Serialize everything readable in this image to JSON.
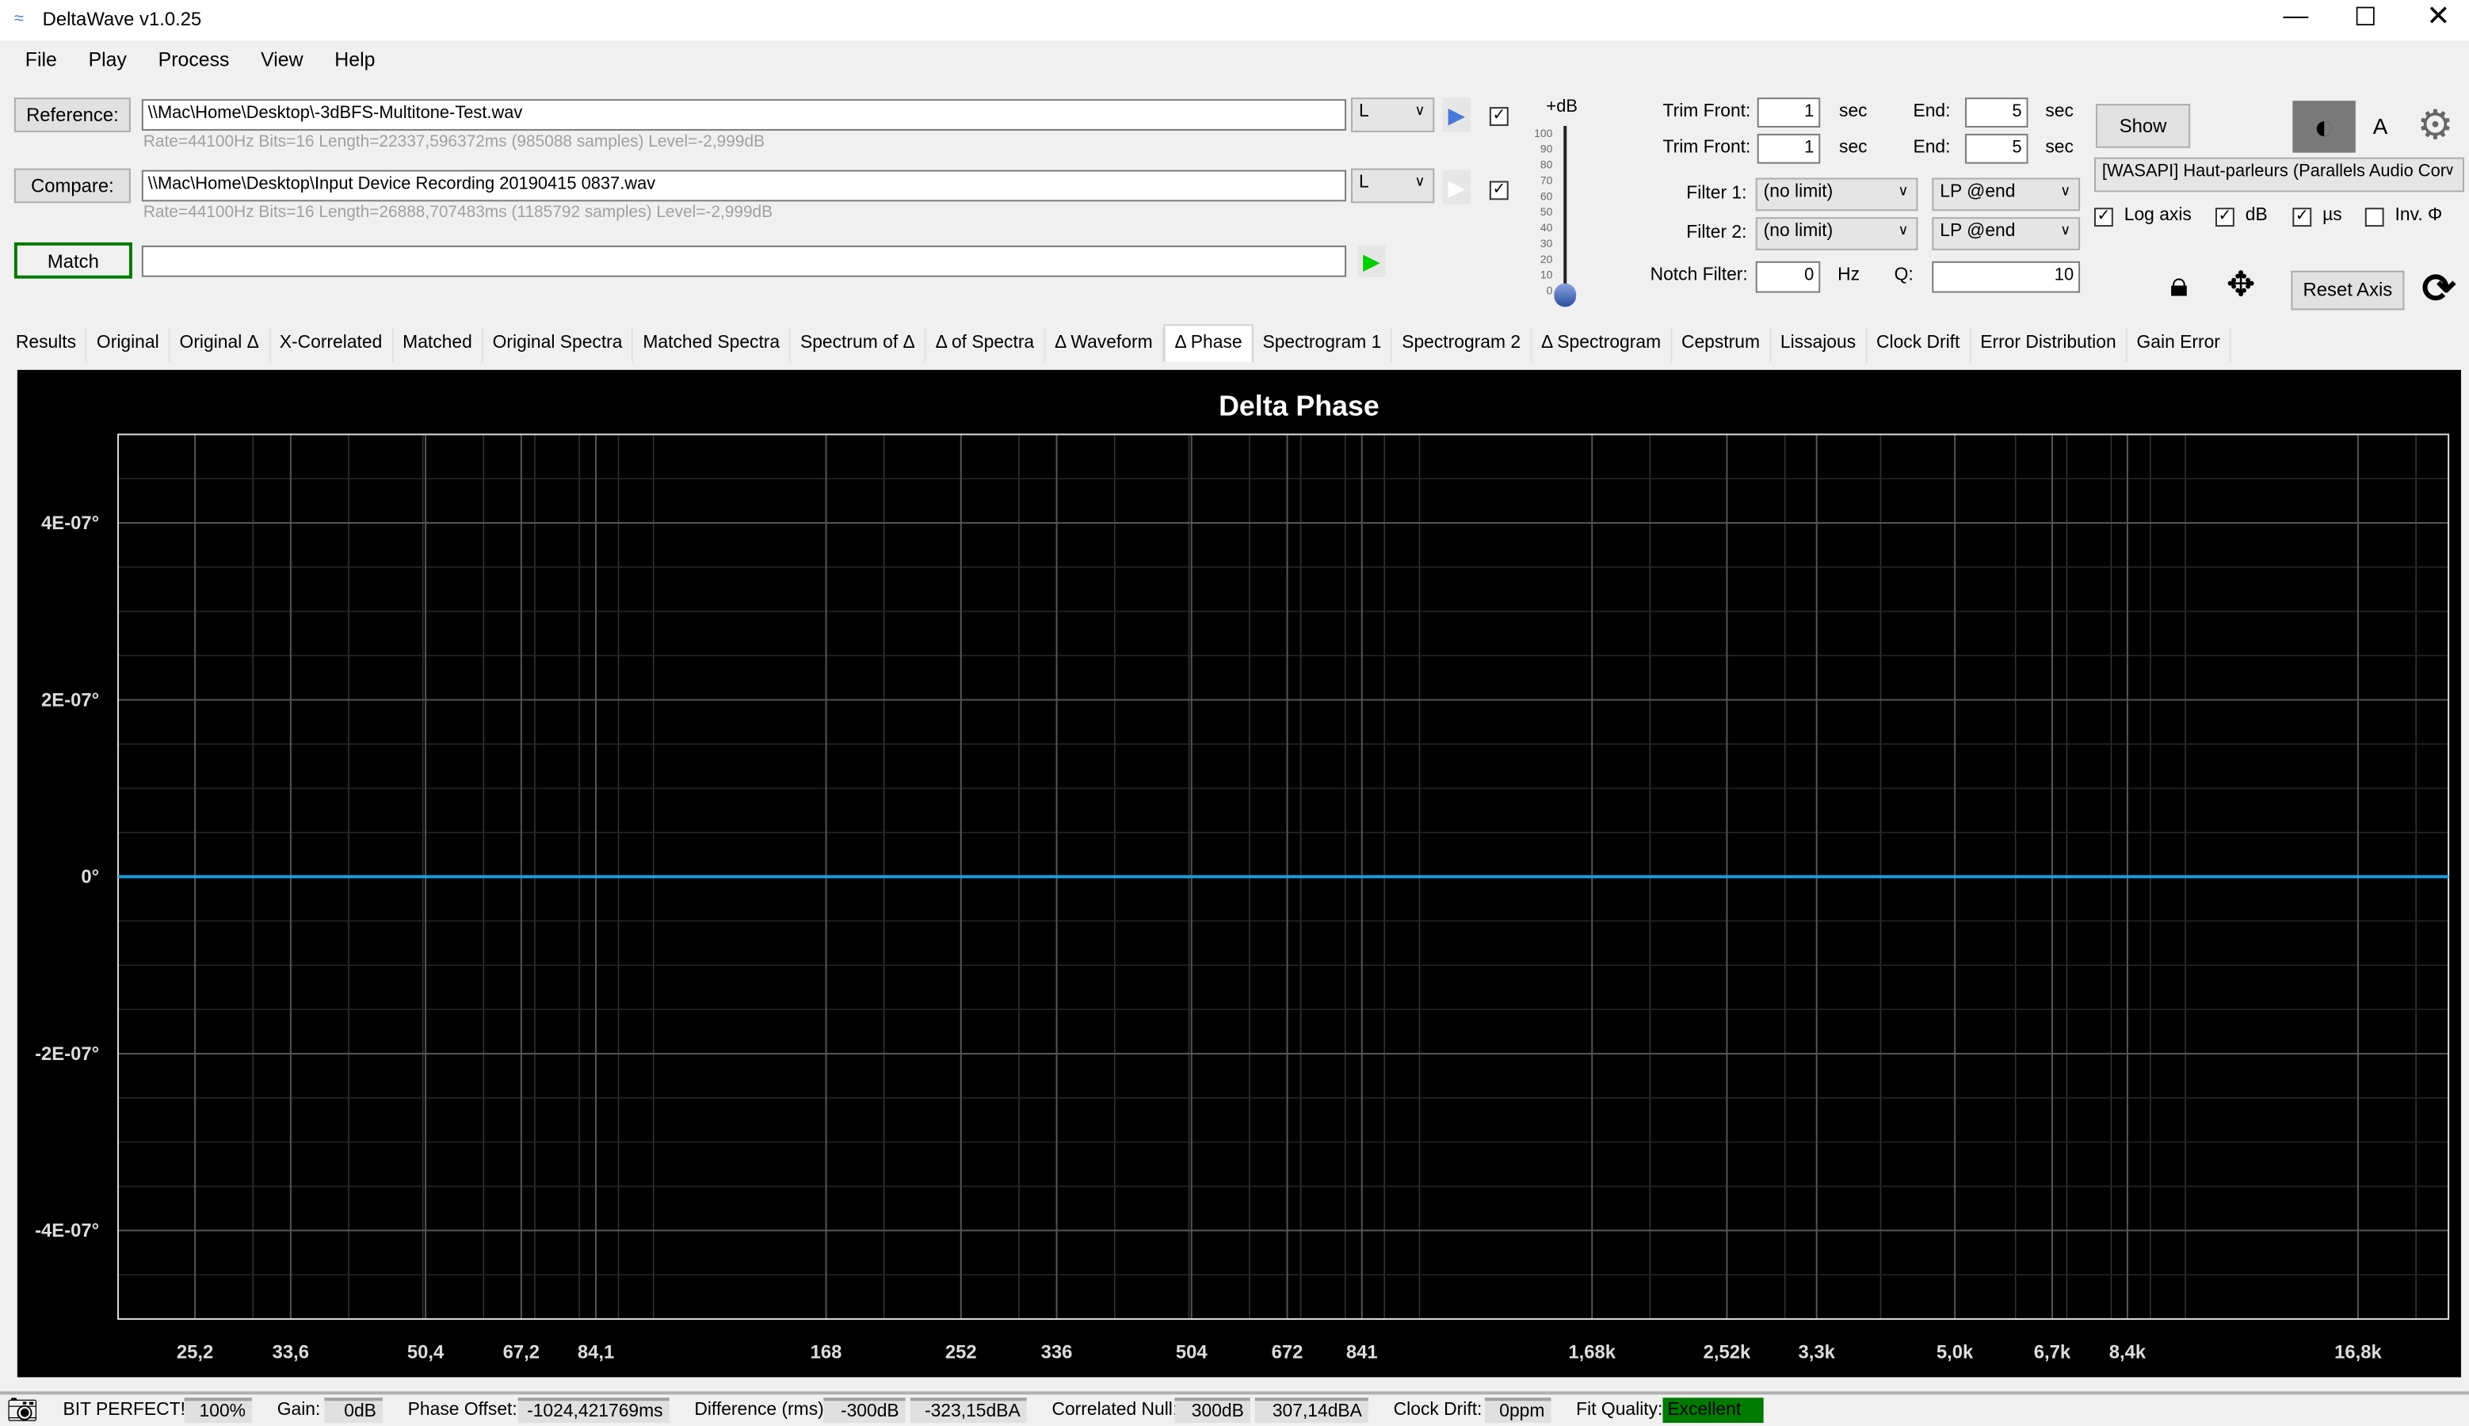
{
  "app": {
    "title": "DeltaWave v1.0.25"
  },
  "menu": [
    "File",
    "Play",
    "Process",
    "View",
    "Help"
  ],
  "reference": {
    "button": "Reference:",
    "path": "\\\\Mac\\Home\\Desktop\\-3dBFS-Multitone-Test.wav",
    "info": "Rate=44100Hz Bits=16 Length=22337,596372ms (985088 samples) Level=-2,999dB",
    "channel": "L",
    "checked": true
  },
  "compare": {
    "button": "Compare:",
    "path": "\\\\Mac\\Home\\Desktop\\Input Device Recording 20190415 0837.wav",
    "info": "Rate=44100Hz Bits=16 Length=26888,707483ms (1185792 samples) Level=-2,999dB",
    "channel": "L",
    "checked": true
  },
  "match": {
    "button": "Match",
    "value": ""
  },
  "volume": {
    "label": "+dB",
    "ticks": [
      "100",
      "90",
      "80",
      "70",
      "60",
      "50",
      "40",
      "30",
      "20",
      "10",
      "0"
    ],
    "level": 0
  },
  "trim": [
    {
      "label": "Trim Front:",
      "front": "1",
      "unit": "sec",
      "end_label": "End:",
      "end": "5",
      "end_unit": "sec"
    },
    {
      "label": "Trim Front:",
      "front": "1",
      "unit": "sec",
      "end_label": "End:",
      "end": "5",
      "end_unit": "sec"
    }
  ],
  "filters": [
    {
      "label": "Filter 1:",
      "value": "(no limit)",
      "type": "LP @end"
    },
    {
      "label": "Filter 2:",
      "value": "(no limit)",
      "type": "LP @end"
    }
  ],
  "notch": {
    "label": "Notch Filter:",
    "value": "0",
    "unit": "Hz",
    "q_label": "Q:",
    "q": "10"
  },
  "show_button": "Show",
  "a_label": "A",
  "device": "[WASAPI] Haut-parleurs (Parallels Audio Cor",
  "options": [
    {
      "label": "Log axis",
      "checked": true
    },
    {
      "label": "dB",
      "checked": true
    },
    {
      "label": "µs",
      "checked": true
    },
    {
      "label": "Inv. Φ",
      "checked": false
    }
  ],
  "reset_axis": "Reset Axis",
  "tabs": [
    "Results",
    "Original",
    "Original Δ",
    "X-Correlated",
    "Matched",
    "Original Spectra",
    "Matched Spectra",
    "Spectrum of Δ",
    "Δ of Spectra",
    "Δ Waveform",
    "Δ Phase",
    "Spectrogram 1",
    "Spectrogram 2",
    "Δ Spectrogram",
    "Cepstrum",
    "Lissajous",
    "Clock Drift",
    "Error Distribution",
    "Gain Error"
  ],
  "active_tab": "Δ Phase",
  "chart_data": {
    "type": "line",
    "title": "Delta Phase",
    "xlabel": "",
    "ylabel": "",
    "xscale": "log",
    "xlim": [
      20,
      22050
    ],
    "ylim": [
      -5e-07,
      5e-07
    ],
    "grid": true,
    "xticks": [
      25.2,
      33.6,
      50.4,
      67.2,
      84.1,
      168,
      252,
      336,
      504,
      672,
      841,
      1680,
      2520,
      3300,
      5000,
      6700,
      8400,
      16800
    ],
    "xtick_labels": [
      "25,2",
      "33,6",
      "50,4",
      "67,2",
      "84,1",
      "168",
      "252",
      "336",
      "504",
      "672",
      "841",
      "1,68k",
      "2,52k",
      "3,3k",
      "5,0k",
      "6,7k",
      "8,4k",
      "16,8k"
    ],
    "yticks": [
      4e-07,
      2e-07,
      0,
      -2e-07,
      -4e-07
    ],
    "ytick_labels": [
      "4E-07°",
      "2E-07°",
      "0°",
      "-2E-07°",
      "-4E-07°"
    ],
    "series": [
      {
        "x": [
          20,
          22050
        ],
        "y": [
          0,
          0
        ],
        "color": "#1e9bd7"
      }
    ]
  },
  "status": {
    "bit_perfect": "BIT PERFECT!",
    "bit_pct": "100%",
    "gain_label": "Gain:",
    "gain": "0dB",
    "phase_label": "Phase Offset:",
    "phase": "-1024,421769ms",
    "diff_label": "Difference (rms):",
    "diff1": "-300dB",
    "diff2": "-323,15dBA",
    "null_label": "Correlated Null:",
    "null1": "300dB",
    "null2": "307,14dBA",
    "drift_label": "Clock Drift:",
    "drift": "0ppm",
    "fit_label": "Fit Quality:",
    "fit": "Excellent",
    "fit_color": "#007a00"
  }
}
